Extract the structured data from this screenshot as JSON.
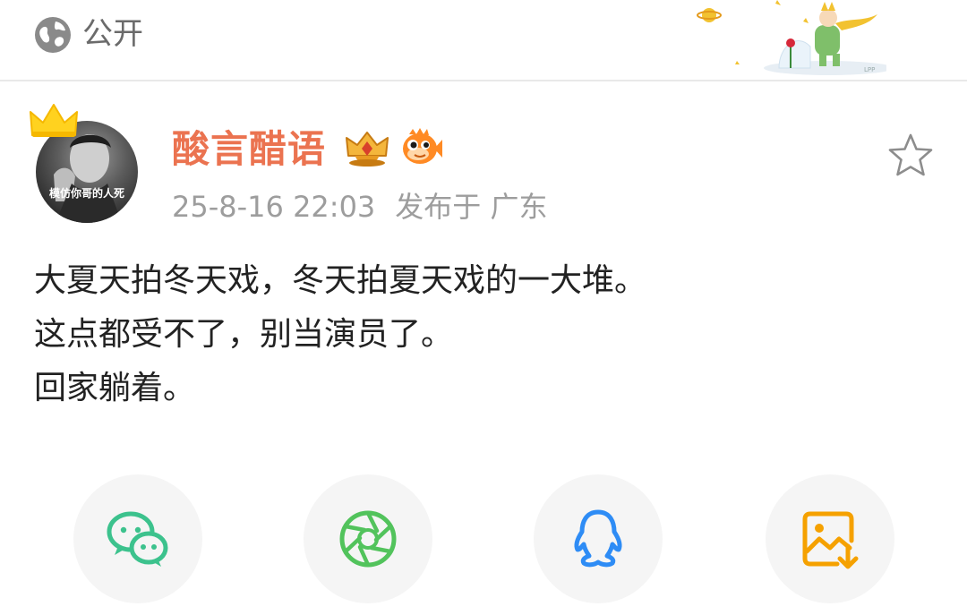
{
  "header": {
    "visibility_label": "公开",
    "decoration_text": "LPP"
  },
  "post": {
    "avatar_caption": "模仿你哥的人死",
    "user_name": "酸言醋语",
    "timestamp": "25-8-16 22:03",
    "location": "发布于 广东",
    "lines": [
      "大夏天拍冬天戏，冬天拍夏天戏的一大堆。",
      "这点都受不了，别当演员了。",
      "回家躺着。"
    ]
  },
  "share": {
    "icons": [
      "wechat-icon",
      "moments-icon",
      "qq-icon",
      "save-image-icon"
    ]
  },
  "colors": {
    "user_name": "#eb7350",
    "meta": "#9d9d9d",
    "text": "#222222",
    "wechat_green": "#3cc28d",
    "moments_green": "#52c35c",
    "qq_blue": "#2e8cf5",
    "save_orange": "#f5a100"
  }
}
